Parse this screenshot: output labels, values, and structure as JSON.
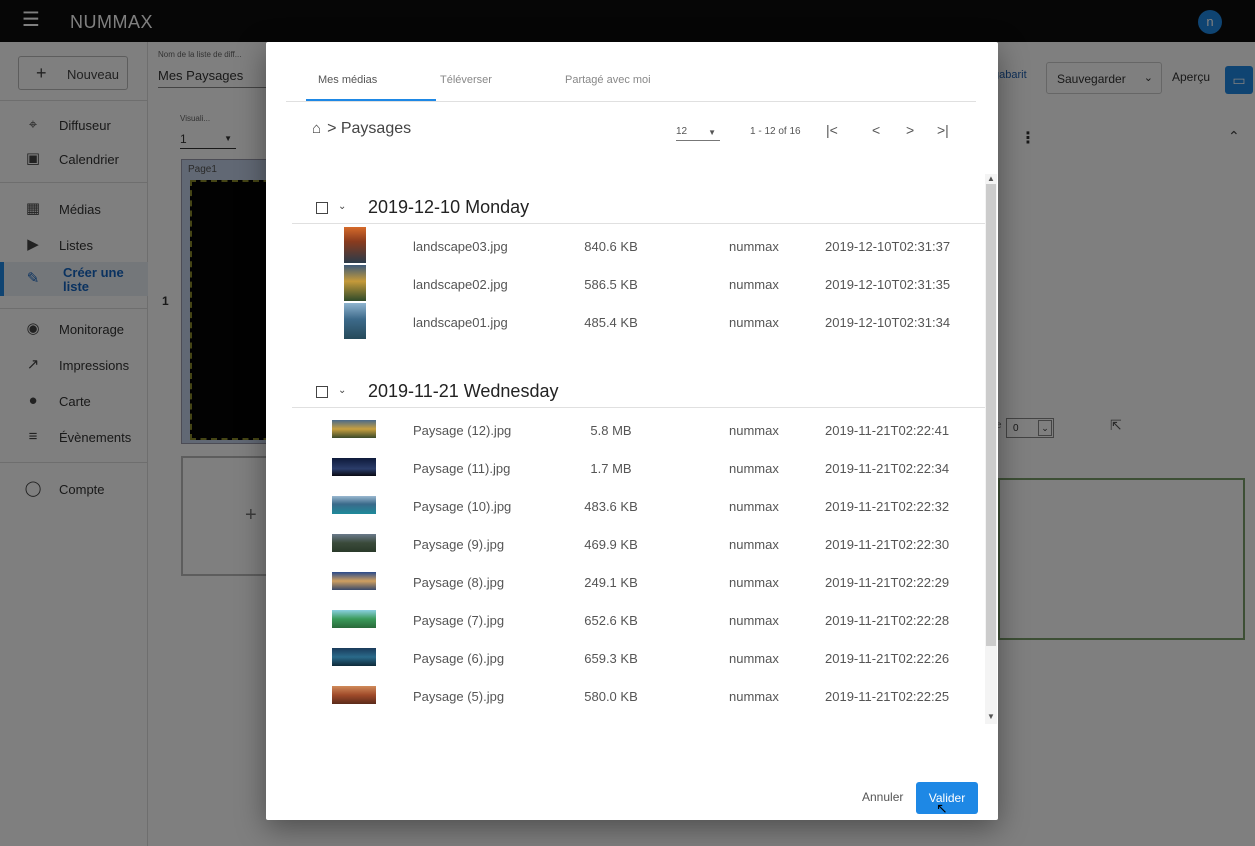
{
  "topbar": {
    "brand": "NUMMAX",
    "avatar_letter": "n",
    "menu_icon": "hamburger-icon"
  },
  "sidebar": {
    "new_button": "Nouveau",
    "items": [
      {
        "label": "Diffuseur",
        "icon": "cast-icon"
      },
      {
        "label": "Calendrier",
        "icon": "calendar-icon"
      },
      {
        "label": "Médias",
        "icon": "image-icon"
      },
      {
        "label": "Listes",
        "icon": "playlist-icon"
      },
      {
        "label": "Créer une liste",
        "icon": "pencil-icon",
        "active": true
      },
      {
        "label": "Monitorage",
        "icon": "eye-icon"
      },
      {
        "label": "Impressions",
        "icon": "trend-icon"
      },
      {
        "label": "Carte",
        "icon": "map-pin-icon"
      },
      {
        "label": "Évènements",
        "icon": "list-icon"
      },
      {
        "label": "Compte",
        "icon": "person-icon"
      }
    ]
  },
  "editor": {
    "list_name_label": "Nom de la liste de diff...",
    "list_name_value": "Mes Paysages",
    "visu_label": "Visuali...",
    "visu_value": "1",
    "page_label": "Page1",
    "row_number": "1",
    "gabarit_label": "gabarit",
    "save_label": "Sauvegarder",
    "preview_label": "Aperçu",
    "zoom_prefix": "e",
    "zoom_value": "0"
  },
  "dialog": {
    "tabs": [
      "Mes médias",
      "Téléverser",
      "Partagé avec moi"
    ],
    "active_tab": "Mes médias",
    "breadcrumb_folder": "Paysages",
    "per_page": "12",
    "range": "1 - 12 of 16",
    "nav": {
      "first": "|<",
      "prev": "<",
      "next": ">",
      "last": ">|"
    },
    "groups": [
      {
        "date": "2019-12-10 Monday",
        "files": [
          {
            "name": "landscape03.jpg",
            "size": "840.6 KB",
            "owner": "nummax",
            "time": "2019-12-10T02:31:37"
          },
          {
            "name": "landscape02.jpg",
            "size": "586.5 KB",
            "owner": "nummax",
            "time": "2019-12-10T02:31:35"
          },
          {
            "name": "landscape01.jpg",
            "size": "485.4 KB",
            "owner": "nummax",
            "time": "2019-12-10T02:31:34"
          }
        ]
      },
      {
        "date": "2019-11-21 Wednesday",
        "files": [
          {
            "name": "Paysage (12).jpg",
            "size": "5.8 MB",
            "owner": "nummax",
            "time": "2019-11-21T02:22:41"
          },
          {
            "name": "Paysage (11).jpg",
            "size": "1.7 MB",
            "owner": "nummax",
            "time": "2019-11-21T02:22:34"
          },
          {
            "name": "Paysage (10).jpg",
            "size": "483.6 KB",
            "owner": "nummax",
            "time": "2019-11-21T02:22:32"
          },
          {
            "name": "Paysage (9).jpg",
            "size": "469.9 KB",
            "owner": "nummax",
            "time": "2019-11-21T02:22:30"
          },
          {
            "name": "Paysage (8).jpg",
            "size": "249.1 KB",
            "owner": "nummax",
            "time": "2019-11-21T02:22:29"
          },
          {
            "name": "Paysage (7).jpg",
            "size": "652.6 KB",
            "owner": "nummax",
            "time": "2019-11-21T02:22:28"
          },
          {
            "name": "Paysage (6).jpg",
            "size": "659.3 KB",
            "owner": "nummax",
            "time": "2019-11-21T02:22:26"
          },
          {
            "name": "Paysage (5).jpg",
            "size": "580.0 KB",
            "owner": "nummax",
            "time": "2019-11-21T02:22:25"
          }
        ]
      }
    ],
    "cancel_label": "Annuler",
    "confirm_label": "Valider"
  },
  "colors": {
    "accent": "#1e88e5",
    "topbar": "#0c0c0c"
  }
}
